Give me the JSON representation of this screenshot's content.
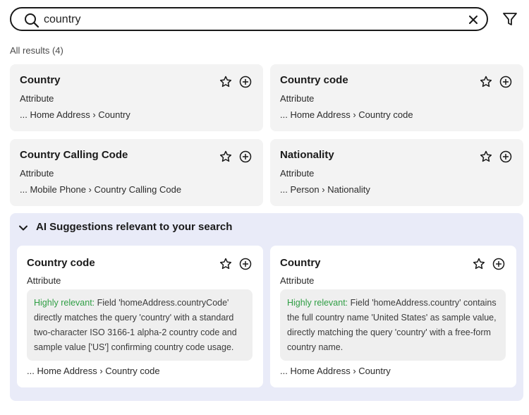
{
  "search": {
    "value": "country",
    "placeholder": ""
  },
  "results_label": "All results (4)",
  "results": [
    {
      "title": "Country",
      "type": "Attribute",
      "path": "... Home Address › Country"
    },
    {
      "title": "Country code",
      "type": "Attribute",
      "path": "... Home Address › Country code"
    },
    {
      "title": "Country Calling Code",
      "type": "Attribute",
      "path": "... Mobile Phone › Country Calling Code"
    },
    {
      "title": "Nationality",
      "type": "Attribute",
      "path": "... Person › Nationality"
    }
  ],
  "ai": {
    "title": "AI Suggestions relevant to your search",
    "cards": [
      {
        "title": "Country code",
        "type": "Attribute",
        "relevance": "Highly relevant:",
        "reason": " Field 'homeAddress.countryCode' directly matches the query 'country' with a standard two-character ISO 3166-1 alpha-2 country code and sample value ['US'] confirming country code usage.",
        "path": "... Home Address › Country code"
      },
      {
        "title": "Country",
        "type": "Attribute",
        "relevance": "Highly relevant:",
        "reason": " Field 'homeAddress.country' contains the full country name 'United States' as sample value, directly matching the query 'country' with a free-form country name.",
        "path": "... Home Address › Country"
      }
    ]
  },
  "icons": {
    "search": "search-icon",
    "clear": "close-icon",
    "filter": "filter-icon",
    "star": "star-icon",
    "add": "add-circle-icon",
    "collapse": "chevron-down-icon"
  },
  "colors": {
    "relevance": "#2f9e44",
    "ai_panel": "#e9ebf8",
    "card": "#f3f3f3"
  }
}
